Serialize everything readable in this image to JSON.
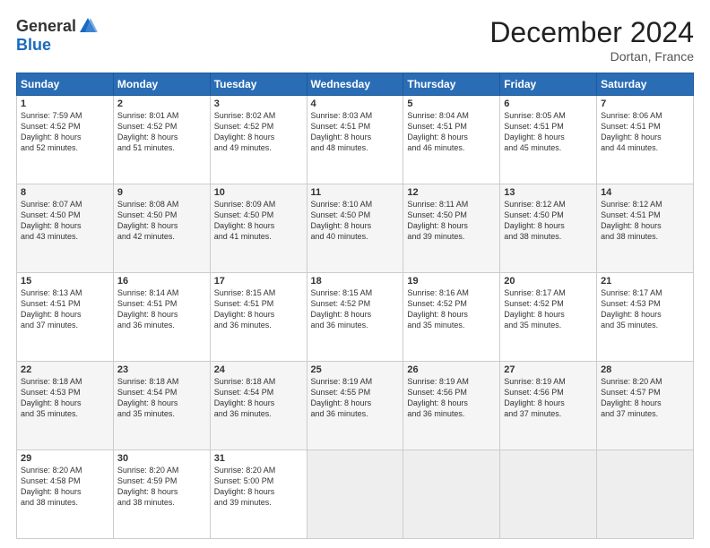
{
  "logo": {
    "general": "General",
    "blue": "Blue"
  },
  "title": "December 2024",
  "location": "Dortan, France",
  "days_header": [
    "Sunday",
    "Monday",
    "Tuesday",
    "Wednesday",
    "Thursday",
    "Friday",
    "Saturday"
  ],
  "weeks": [
    [
      {
        "num": "1",
        "sunrise": "7:59 AM",
        "sunset": "4:52 PM",
        "daylight": "8 hours and 52 minutes."
      },
      {
        "num": "2",
        "sunrise": "8:01 AM",
        "sunset": "4:52 PM",
        "daylight": "8 hours and 51 minutes."
      },
      {
        "num": "3",
        "sunrise": "8:02 AM",
        "sunset": "4:52 PM",
        "daylight": "8 hours and 49 minutes."
      },
      {
        "num": "4",
        "sunrise": "8:03 AM",
        "sunset": "4:51 PM",
        "daylight": "8 hours and 48 minutes."
      },
      {
        "num": "5",
        "sunrise": "8:04 AM",
        "sunset": "4:51 PM",
        "daylight": "8 hours and 46 minutes."
      },
      {
        "num": "6",
        "sunrise": "8:05 AM",
        "sunset": "4:51 PM",
        "daylight": "8 hours and 45 minutes."
      },
      {
        "num": "7",
        "sunrise": "8:06 AM",
        "sunset": "4:51 PM",
        "daylight": "8 hours and 44 minutes."
      }
    ],
    [
      {
        "num": "8",
        "sunrise": "8:07 AM",
        "sunset": "4:50 PM",
        "daylight": "8 hours and 43 minutes."
      },
      {
        "num": "9",
        "sunrise": "8:08 AM",
        "sunset": "4:50 PM",
        "daylight": "8 hours and 42 minutes."
      },
      {
        "num": "10",
        "sunrise": "8:09 AM",
        "sunset": "4:50 PM",
        "daylight": "8 hours and 41 minutes."
      },
      {
        "num": "11",
        "sunrise": "8:10 AM",
        "sunset": "4:50 PM",
        "daylight": "8 hours and 40 minutes."
      },
      {
        "num": "12",
        "sunrise": "8:11 AM",
        "sunset": "4:50 PM",
        "daylight": "8 hours and 39 minutes."
      },
      {
        "num": "13",
        "sunrise": "8:12 AM",
        "sunset": "4:50 PM",
        "daylight": "8 hours and 38 minutes."
      },
      {
        "num": "14",
        "sunrise": "8:12 AM",
        "sunset": "4:51 PM",
        "daylight": "8 hours and 38 minutes."
      }
    ],
    [
      {
        "num": "15",
        "sunrise": "8:13 AM",
        "sunset": "4:51 PM",
        "daylight": "8 hours and 37 minutes."
      },
      {
        "num": "16",
        "sunrise": "8:14 AM",
        "sunset": "4:51 PM",
        "daylight": "8 hours and 36 minutes."
      },
      {
        "num": "17",
        "sunrise": "8:15 AM",
        "sunset": "4:51 PM",
        "daylight": "8 hours and 36 minutes."
      },
      {
        "num": "18",
        "sunrise": "8:15 AM",
        "sunset": "4:52 PM",
        "daylight": "8 hours and 36 minutes."
      },
      {
        "num": "19",
        "sunrise": "8:16 AM",
        "sunset": "4:52 PM",
        "daylight": "8 hours and 35 minutes."
      },
      {
        "num": "20",
        "sunrise": "8:17 AM",
        "sunset": "4:52 PM",
        "daylight": "8 hours and 35 minutes."
      },
      {
        "num": "21",
        "sunrise": "8:17 AM",
        "sunset": "4:53 PM",
        "daylight": "8 hours and 35 minutes."
      }
    ],
    [
      {
        "num": "22",
        "sunrise": "8:18 AM",
        "sunset": "4:53 PM",
        "daylight": "8 hours and 35 minutes."
      },
      {
        "num": "23",
        "sunrise": "8:18 AM",
        "sunset": "4:54 PM",
        "daylight": "8 hours and 35 minutes."
      },
      {
        "num": "24",
        "sunrise": "8:18 AM",
        "sunset": "4:54 PM",
        "daylight": "8 hours and 36 minutes."
      },
      {
        "num": "25",
        "sunrise": "8:19 AM",
        "sunset": "4:55 PM",
        "daylight": "8 hours and 36 minutes."
      },
      {
        "num": "26",
        "sunrise": "8:19 AM",
        "sunset": "4:56 PM",
        "daylight": "8 hours and 36 minutes."
      },
      {
        "num": "27",
        "sunrise": "8:19 AM",
        "sunset": "4:56 PM",
        "daylight": "8 hours and 37 minutes."
      },
      {
        "num": "28",
        "sunrise": "8:20 AM",
        "sunset": "4:57 PM",
        "daylight": "8 hours and 37 minutes."
      }
    ],
    [
      {
        "num": "29",
        "sunrise": "8:20 AM",
        "sunset": "4:58 PM",
        "daylight": "8 hours and 38 minutes."
      },
      {
        "num": "30",
        "sunrise": "8:20 AM",
        "sunset": "4:59 PM",
        "daylight": "8 hours and 38 minutes."
      },
      {
        "num": "31",
        "sunrise": "8:20 AM",
        "sunset": "5:00 PM",
        "daylight": "8 hours and 39 minutes."
      },
      null,
      null,
      null,
      null
    ]
  ]
}
